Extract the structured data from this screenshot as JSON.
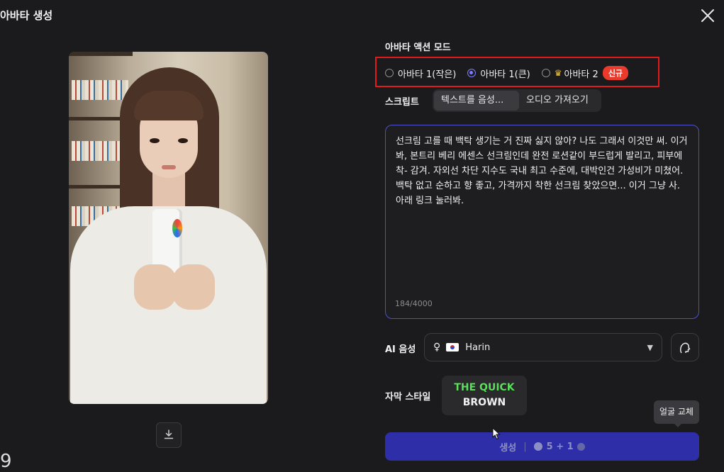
{
  "header": {
    "title": "아바타 생성"
  },
  "preview": {
    "download_icon": "download-icon"
  },
  "corner_text": "9",
  "action_mode": {
    "label": "아바타 액션 모드",
    "options": [
      {
        "label": "아바타 1(작은)",
        "selected": false
      },
      {
        "label": "아바타 1(큰)",
        "selected": true
      },
      {
        "label": "아바타 2",
        "selected": false,
        "icon": "crown-icon",
        "badge": "신규"
      }
    ]
  },
  "script": {
    "label": "스크립트",
    "tabs": [
      {
        "label": "텍스트를 음성...",
        "active": true
      },
      {
        "label": "오디오 가져오기",
        "active": false
      }
    ],
    "text": "선크림 고를 때 백탁 생기는 거 진짜 싫지 않아? 나도 그래서 이것만 써. 이거 봐, 본트리 베리 에센스 선크림인데 완전 로션같이 부드럽게 발리고, 피부에 착- 감겨. 자외선 차단 지수도 국내 최고 수준에, 대박인건 가성비가 미쳤어. 백탁 없고 순하고 향 좋고, 가격까지 착한 선크림 찾았으면... 이거 그냥 사. 아래 링크 눌러봐.",
    "counter": "184/4000"
  },
  "voice": {
    "label": "AI 음성",
    "selected": "Harin",
    "gender_icon": "female-icon",
    "flag_icon": "korea-flag-icon"
  },
  "subtitle": {
    "label": "자막 스타일",
    "preview_line1": "THE QUICK",
    "preview_line2": "BROWN"
  },
  "tooltip": {
    "text": "얼굴 교체"
  },
  "generate": {
    "label": "생성",
    "cost": "5 + 1"
  },
  "colors": {
    "accent": "#4f50c9",
    "button": "#2e2ea8",
    "highlight_box": "#e11a1a",
    "badge": "#e93a2c"
  }
}
